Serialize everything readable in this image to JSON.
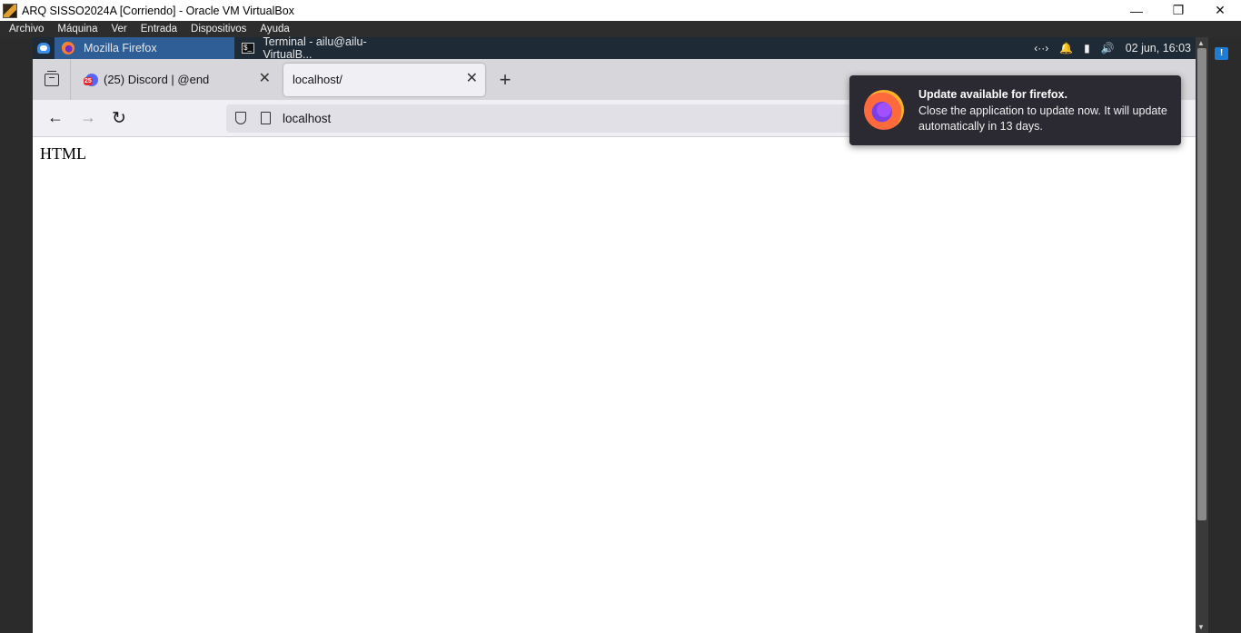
{
  "host_window": {
    "title": "ARQ SISSO2024A [Corriendo] - Oracle VM VirtualBox",
    "controls": {
      "minimize": "—",
      "maximize": "❐",
      "close": "✕"
    }
  },
  "host_menu": [
    "Archivo",
    "Máquina",
    "Ver",
    "Entrada",
    "Dispositivos",
    "Ayuda"
  ],
  "guest_panel": {
    "tasks": [
      {
        "label": "Mozilla Firefox",
        "icon": "firefox-icon",
        "active": true
      },
      {
        "label": "Terminal - ailu@ailu-VirtualB...",
        "icon": "terminal-icon",
        "active": false
      }
    ],
    "clock": "02 jun, 16:03"
  },
  "browser": {
    "tabs": [
      {
        "title": "(25) Discord | @end",
        "badge": "25",
        "icon": "discord-icon"
      },
      {
        "title": "localhost/",
        "icon": "page-icon"
      }
    ],
    "url": "localhost",
    "page_text": "HTML"
  },
  "notification": {
    "title": "Update available for firefox.",
    "message": "Close the application to update now. It will update automatically in 13 days."
  }
}
